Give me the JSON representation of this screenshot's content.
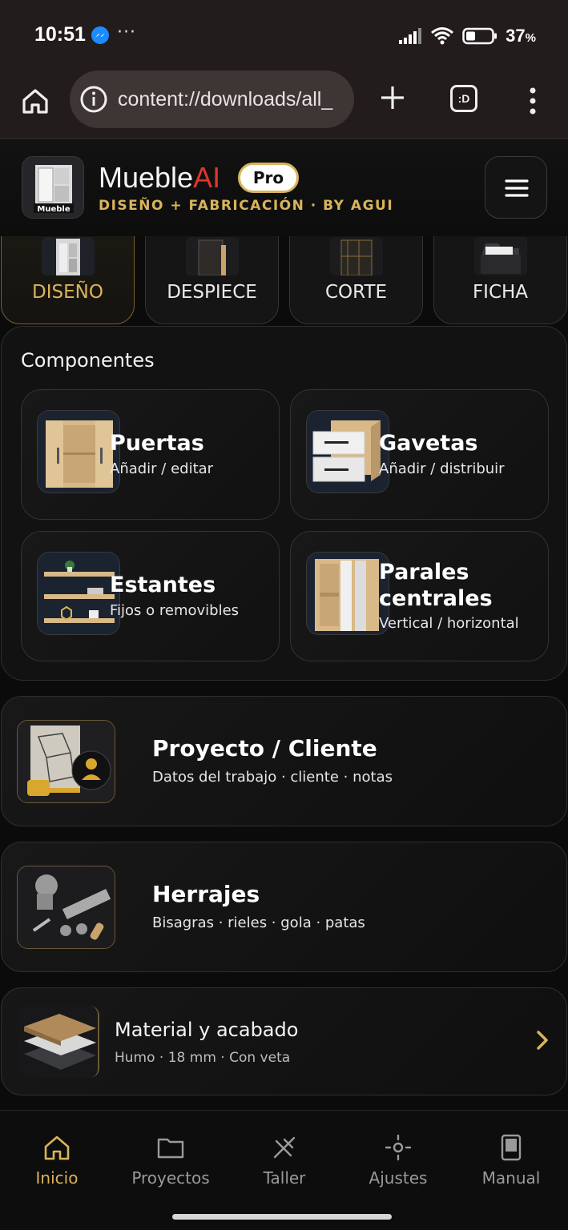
{
  "status_bar": {
    "time": "10:51",
    "dots": "···",
    "battery": "37",
    "battery_unit": "%"
  },
  "browser": {
    "url": "content://downloads/all_",
    "tabs_label": ":D"
  },
  "header": {
    "title_main": "Mueble",
    "title_accent": "AI",
    "badge": "Pro",
    "subtitle": "DISEÑO + FABRICACIÓN · BY AGUI"
  },
  "tabs": [
    {
      "label": "DISEÑO",
      "active": true
    },
    {
      "label": "DESPIECE",
      "active": false
    },
    {
      "label": "CORTE",
      "active": false
    },
    {
      "label": "FICHA",
      "active": false
    }
  ],
  "components": {
    "title": "Componentes",
    "items": [
      {
        "title": "Puertas",
        "subtitle": "Añadir / editar"
      },
      {
        "title": "Gavetas",
        "subtitle": "Añadir / distribuir"
      },
      {
        "title": "Estantes",
        "subtitle": "Fijos o removibles"
      },
      {
        "title_line1": "Parales",
        "title_line2": "centrales",
        "subtitle": "Vertical / horizontal"
      }
    ]
  },
  "project_card": {
    "title": "Proyecto / Cliente",
    "subtitle": "Datos del trabajo · cliente · notas"
  },
  "hardware_card": {
    "title": "Herrajes",
    "subtitle": "Bisagras · rieles · gola · patas"
  },
  "material_card": {
    "title": "Material y acabado",
    "subtitle": "Humo · 18 mm · Con veta"
  },
  "bottom_nav": [
    {
      "label": "Inicio",
      "icon": "home-icon",
      "active": true
    },
    {
      "label": "Proyectos",
      "icon": "folder-icon",
      "active": false
    },
    {
      "label": "Taller",
      "icon": "tools-icon",
      "active": false
    },
    {
      "label": "Ajustes",
      "icon": "settings-icon",
      "active": false
    },
    {
      "label": "Manual",
      "icon": "book-icon",
      "active": false
    }
  ],
  "colors": {
    "accent_gold": "#d9b45a",
    "brand_red": "#e0352b",
    "background": "#0b0b0c"
  }
}
